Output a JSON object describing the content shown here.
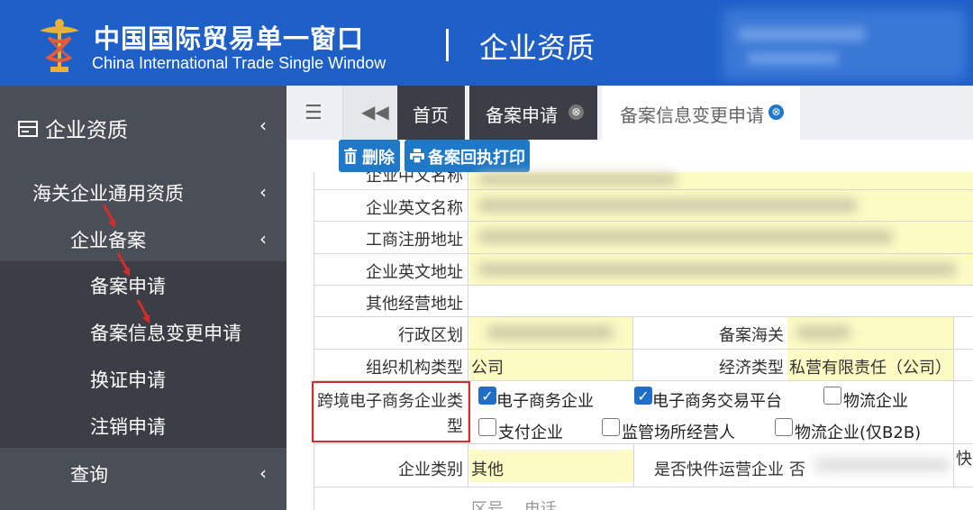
{
  "header": {
    "brand_cn": "中国国际贸易单一窗口",
    "brand_en": "China International Trade Single Window",
    "section_title": "企业资质"
  },
  "sidebar": {
    "title": "企业资质",
    "items": [
      {
        "label": "海关企业通用资质"
      },
      {
        "label": "企业备案"
      },
      {
        "label": "备案申请"
      },
      {
        "label": "备案信息变更申请"
      },
      {
        "label": "换证申请"
      },
      {
        "label": "注销申请"
      },
      {
        "label": "查询"
      }
    ]
  },
  "tabs": {
    "home": "首页",
    "apply": "备案申请",
    "change": "备案信息变更申请",
    "close_icon": "⊗"
  },
  "toolbar": {
    "delete_label": "删除",
    "print_label": "备案回执打印"
  },
  "form": {
    "rows": [
      {
        "label": "企业中文名称"
      },
      {
        "label": "企业英文名称"
      },
      {
        "label": "工商注册地址"
      },
      {
        "label": "企业英文地址"
      },
      {
        "label": "其他经营地址"
      }
    ],
    "region_label": "行政区划",
    "customs_label": "备案海关",
    "org_type_label": "组织机构类型",
    "org_type_value": "公司",
    "econ_type_label": "经济类型",
    "econ_type_value": "私营有限责任（公司）",
    "ecom_label_line1": "跨境电子商务企业类",
    "ecom_label_line2": "型",
    "ecom_options": [
      {
        "label": "电子商务企业",
        "checked": true
      },
      {
        "label": "电子商务交易平台",
        "checked": true
      },
      {
        "label": "物流企业",
        "checked": false
      },
      {
        "label": "支付企业",
        "checked": false
      },
      {
        "label": "监管场所经营人",
        "checked": false
      },
      {
        "label": "物流企业(仅B2B)",
        "checked": false
      }
    ],
    "category_label": "企业类别",
    "category_value": "其他",
    "express_label": "是否快件运营企业",
    "express_value": "否",
    "express_extra": "快",
    "bottom_partial": "区号    电话"
  },
  "colors": {
    "header_bg": "#1f5fc8",
    "sidebar_bg": "#4a4e57",
    "sidebar_active_bg": "#3b3e45",
    "field_highlight": "#fdfbc4",
    "button_bg": "#1f78c8",
    "annotation_red": "#d62b2b"
  }
}
